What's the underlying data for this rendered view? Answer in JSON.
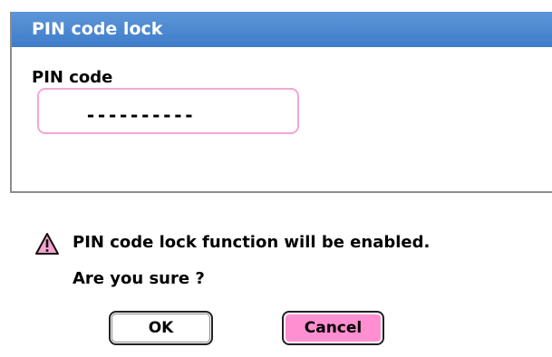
{
  "dialog": {
    "title": "PIN code lock",
    "field_label": "PIN code",
    "pin_value": "----------",
    "accent": "#4a86cf",
    "input_border": "#f3a6d3"
  },
  "message": {
    "icon": "warning-icon",
    "line1": "PIN code lock function will be enabled.",
    "line2": "Are you sure ?"
  },
  "buttons": {
    "ok_label": "OK",
    "cancel_label": "Cancel",
    "cancel_color": "#ff8fd0"
  }
}
